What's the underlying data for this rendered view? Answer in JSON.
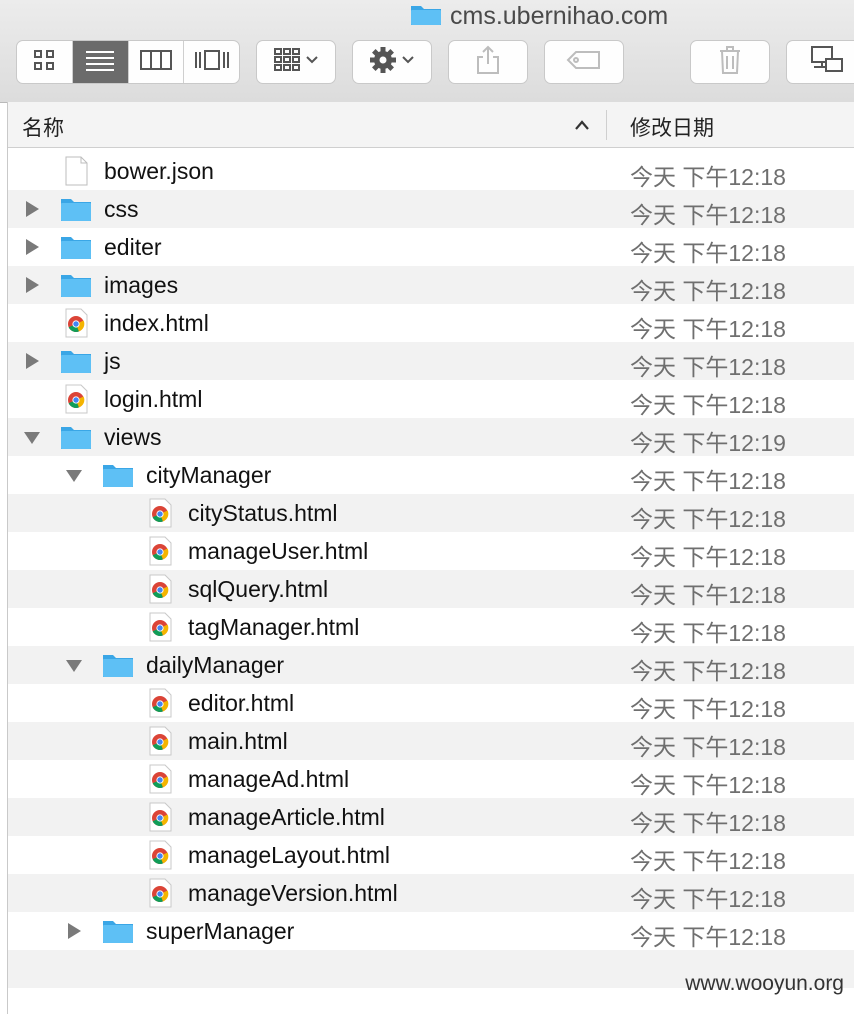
{
  "window": {
    "title": "cms.ubernihao.com",
    "title_icon": "folder-icon"
  },
  "toolbar": {
    "view_modes": [
      "icon-view",
      "list-view",
      "column-view",
      "cover-flow-view"
    ],
    "active_view": "list-view",
    "buttons": [
      "arrange",
      "action",
      "share",
      "tags",
      "delete",
      "connect"
    ]
  },
  "columns": {
    "name": "名称",
    "date": "修改日期",
    "sort": "ascending"
  },
  "rows": [
    {
      "name": "bower.json",
      "date": "今天 下午12:18",
      "type": "file",
      "depth": 0,
      "disclosure": "none"
    },
    {
      "name": "css",
      "date": "今天 下午12:18",
      "type": "folder",
      "depth": 0,
      "disclosure": "collapsed"
    },
    {
      "name": "editer",
      "date": "今天 下午12:18",
      "type": "folder",
      "depth": 0,
      "disclosure": "collapsed"
    },
    {
      "name": "images",
      "date": "今天 下午12:18",
      "type": "folder",
      "depth": 0,
      "disclosure": "collapsed"
    },
    {
      "name": "index.html",
      "date": "今天 下午12:18",
      "type": "html",
      "depth": 0,
      "disclosure": "none"
    },
    {
      "name": "js",
      "date": "今天 下午12:18",
      "type": "folder",
      "depth": 0,
      "disclosure": "collapsed"
    },
    {
      "name": "login.html",
      "date": "今天 下午12:18",
      "type": "html",
      "depth": 0,
      "disclosure": "none"
    },
    {
      "name": "views",
      "date": "今天 下午12:19",
      "type": "folder",
      "depth": 0,
      "disclosure": "expanded"
    },
    {
      "name": "cityManager",
      "date": "今天 下午12:18",
      "type": "folder",
      "depth": 1,
      "disclosure": "expanded"
    },
    {
      "name": "cityStatus.html",
      "date": "今天 下午12:18",
      "type": "html",
      "depth": 2,
      "disclosure": "none"
    },
    {
      "name": "manageUser.html",
      "date": "今天 下午12:18",
      "type": "html",
      "depth": 2,
      "disclosure": "none"
    },
    {
      "name": "sqlQuery.html",
      "date": "今天 下午12:18",
      "type": "html",
      "depth": 2,
      "disclosure": "none"
    },
    {
      "name": "tagManager.html",
      "date": "今天 下午12:18",
      "type": "html",
      "depth": 2,
      "disclosure": "none"
    },
    {
      "name": "dailyManager",
      "date": "今天 下午12:18",
      "type": "folder",
      "depth": 1,
      "disclosure": "expanded"
    },
    {
      "name": "editor.html",
      "date": "今天 下午12:18",
      "type": "html",
      "depth": 2,
      "disclosure": "none"
    },
    {
      "name": "main.html",
      "date": "今天 下午12:18",
      "type": "html",
      "depth": 2,
      "disclosure": "none"
    },
    {
      "name": "manageAd.html",
      "date": "今天 下午12:18",
      "type": "html",
      "depth": 2,
      "disclosure": "none"
    },
    {
      "name": "manageArticle.html",
      "date": "今天 下午12:18",
      "type": "html",
      "depth": 2,
      "disclosure": "none"
    },
    {
      "name": "manageLayout.html",
      "date": "今天 下午12:18",
      "type": "html",
      "depth": 2,
      "disclosure": "none"
    },
    {
      "name": "manageVersion.html",
      "date": "今天 下午12:18",
      "type": "html",
      "depth": 2,
      "disclosure": "none"
    },
    {
      "name": "superManager",
      "date": "今天 下午12:18",
      "type": "folder",
      "depth": 1,
      "disclosure": "collapsed"
    }
  ],
  "watermark": "www.wooyun.org",
  "colors": {
    "folder": "#5ec0f5",
    "folder_dark": "#3aa6e6",
    "stripe": "#f2f2f2",
    "date_text": "#6f6f6f",
    "active_segment": "#6b6b6b"
  }
}
